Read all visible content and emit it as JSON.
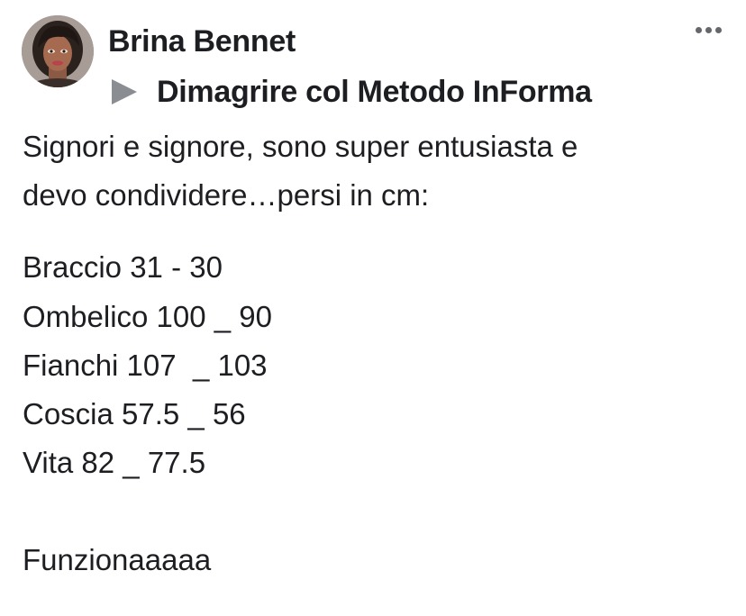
{
  "post": {
    "author": "Brina Bennet",
    "group": "Dimagrire col Metodo InForma",
    "lines": {
      "l1": "Signori e signore, sono super entusiasta e",
      "l2": "devo condividere…persi in cm:",
      "l3": "Braccio 31 - 30",
      "l4": "Ombelico 100 _ 90",
      "l5": "Fianchi 107  _ 103",
      "l6": "Coscia 57.5 _ 56",
      "l7": "Vita 82 _ 77.5",
      "l8": "Funzionaaaaa"
    }
  },
  "icons": {
    "more": "more-options-icon",
    "arrow": "triangle-right-icon",
    "avatar": "profile-avatar"
  },
  "colors": {
    "text": "#1c1e21",
    "secondary": "#65676b",
    "arrow": "#8a8d91"
  }
}
